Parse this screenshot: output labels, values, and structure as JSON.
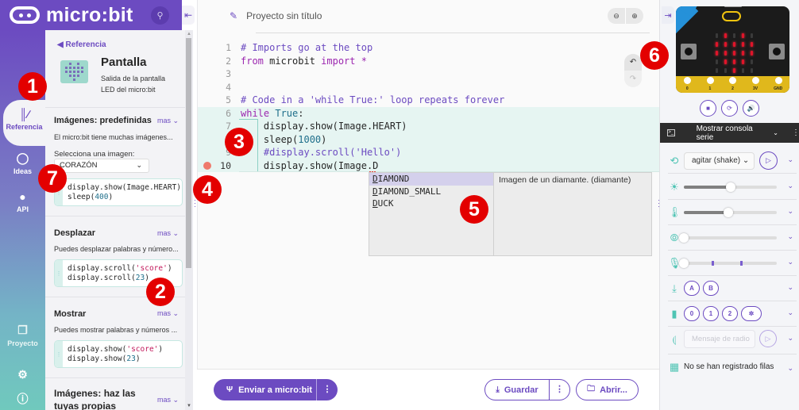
{
  "header": {
    "logo_text": "micro:bit",
    "search_icon": "search-icon",
    "collapse_icon": "collapse-left-icon"
  },
  "sidebar": {
    "items": [
      {
        "label": "Referencia",
        "icon": "library-icon",
        "active": true
      },
      {
        "label": "Ideas",
        "icon": "lightbulb-icon"
      },
      {
        "label": "API",
        "icon": "python-icon"
      },
      {
        "label": "Proyecto",
        "icon": "files-icon"
      },
      {
        "label": "",
        "icon": "settings-icon"
      },
      {
        "label": "",
        "icon": "help-icon"
      }
    ]
  },
  "reference": {
    "back_label": "Referencia",
    "topic_title": "Pantalla",
    "topic_subtitle": "Salida de la pantalla LED del micro:bit",
    "sections": [
      {
        "title": "Imágenes: predefinidas",
        "more": "mas",
        "description": "El micro:bit tiene muchas imágenes...",
        "select_label": "Selecciona una imagen:",
        "select_value": "CORAZÓN",
        "code": [
          "display.show(Image.HEART)",
          "sleep(400)"
        ]
      },
      {
        "title": "Desplazar",
        "more": "mas",
        "description": "Puedes desplazar palabras y número...",
        "code": [
          "display.scroll('score')",
          "display.scroll(23)"
        ]
      },
      {
        "title": "Mostrar",
        "more": "mas",
        "description": "Puedes mostrar palabras y números ...",
        "code": [
          "display.show('score')",
          "display.show(23)"
        ]
      },
      {
        "title": "Imágenes: haz las tuyas propias",
        "more": "mas"
      }
    ]
  },
  "editor": {
    "project_title": "Proyecto sin título",
    "zoom_out": "zoom-out-icon",
    "zoom_in": "zoom-in-icon",
    "lines": [
      {
        "n": "1",
        "text": "# Imports go at the top"
      },
      {
        "n": "2",
        "text": "from microbit import *"
      },
      {
        "n": "3",
        "text": ""
      },
      {
        "n": "4",
        "text": ""
      },
      {
        "n": "5",
        "text": "# Code in a 'while True:' loop repeats forever"
      },
      {
        "n": "6",
        "text": "while True:"
      },
      {
        "n": "7",
        "text": "    display.show(Image.HEART)"
      },
      {
        "n": "8",
        "text": "    sleep(1000)"
      },
      {
        "n": "9",
        "text": "    #display.scroll('Hello')"
      },
      {
        "n": "10",
        "text": "    display.show(Image.D"
      }
    ],
    "autocomplete": {
      "items": [
        "DIAMOND",
        "DIAMOND_SMALL",
        "DUCK"
      ],
      "selected": "DIAMOND",
      "doc": "Imagen de un diamante. (diamante)"
    }
  },
  "footer": {
    "send_label": "Enviar a micro:bit",
    "save_label": "Guardar",
    "open_label": "Abrir..."
  },
  "simulator": {
    "pin_labels": [
      "0",
      "1",
      "2",
      "3V",
      "GND"
    ],
    "led_matrix": [
      [
        0,
        1,
        0,
        1,
        0
      ],
      [
        1,
        1,
        1,
        1,
        1
      ],
      [
        1,
        1,
        1,
        1,
        1
      ],
      [
        0,
        1,
        1,
        1,
        0
      ],
      [
        0,
        0,
        1,
        0,
        0
      ]
    ],
    "serial_label": "Mostrar consola serie",
    "gesture_value": "agitar (shake)",
    "light_level": 0.5,
    "temperature_level": 0.48,
    "compass_level": 0.0,
    "sound_level": 0.0,
    "buttons": [
      "A",
      "B"
    ],
    "touch_pins": [
      "0",
      "1",
      "2"
    ],
    "radio_placeholder": "Mensaje de radio",
    "log_text": "No se han registrado filas"
  },
  "annotations": [
    "1",
    "2",
    "3",
    "4",
    "5",
    "6",
    "7"
  ],
  "colors": {
    "brand": "#6c4bc1",
    "accent_teal": "#4fc4b4",
    "led_on": "#e0142a",
    "badge": "#e30000"
  }
}
